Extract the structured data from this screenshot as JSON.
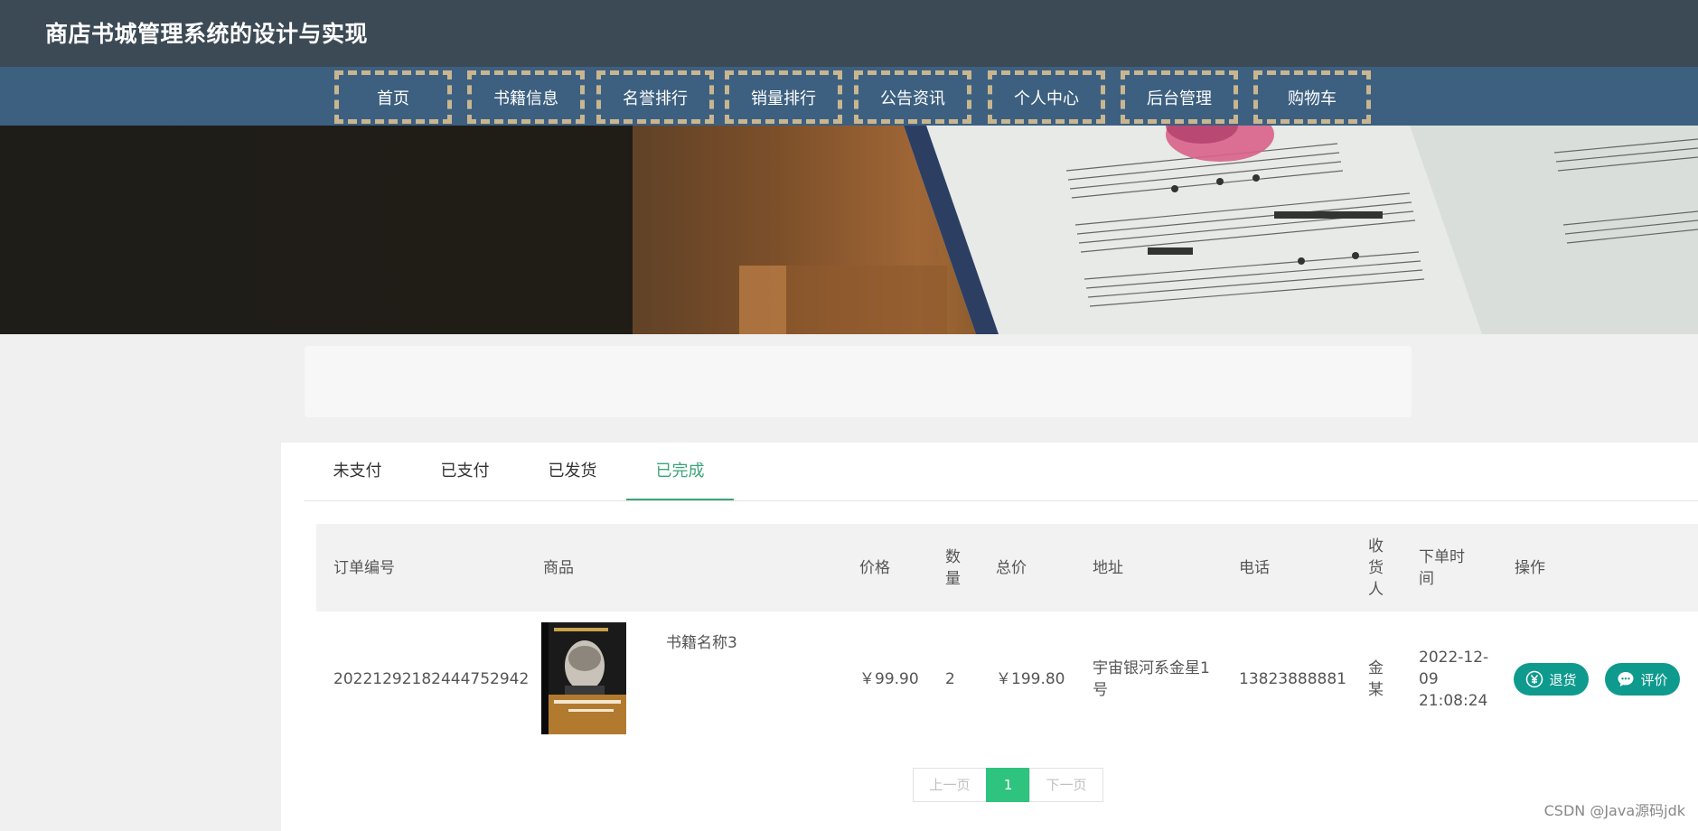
{
  "header": {
    "title": "商店书城管理系统的设计与实现"
  },
  "nav": {
    "items": [
      {
        "label": "首页"
      },
      {
        "label": "书籍信息"
      },
      {
        "label": "名誉排行"
      },
      {
        "label": "销量排行"
      },
      {
        "label": "公告资讯"
      },
      {
        "label": "个人中心"
      },
      {
        "label": "后台管理"
      },
      {
        "label": "购物车"
      }
    ]
  },
  "tabs": [
    {
      "label": "未支付"
    },
    {
      "label": "已支付"
    },
    {
      "label": "已发货"
    },
    {
      "label": "已完成",
      "active": true
    }
  ],
  "table": {
    "headers": {
      "order_no": "订单编号",
      "product": "商品",
      "price": "价格",
      "qty": "数量",
      "total": "总价",
      "address": "地址",
      "phone": "电话",
      "receiver": "收货人",
      "order_time": "下单时间",
      "actions": "操作"
    },
    "rows": [
      {
        "order_no": "20221292182444752942",
        "product_name": "书籍名称3",
        "price": "￥99.90",
        "qty": "2",
        "total": "￥199.80",
        "address": "宇宙银河系金星1号",
        "phone": "13823888881",
        "receiver": "金某",
        "order_time": "2022-12-09 21:08:24",
        "return_label": "退货",
        "review_label": "评价"
      }
    ]
  },
  "pagination": {
    "prev": "上一页",
    "current": "1",
    "next": "下一页"
  },
  "watermark": "CSDN @Java源码jdk",
  "colors": {
    "topbar": "#3c4a55",
    "navbar": "#3d6080",
    "nav_border": "#c9b690",
    "accent": "#3aa57a",
    "button": "#0f9a8e",
    "pager_current": "#2ec37f"
  }
}
